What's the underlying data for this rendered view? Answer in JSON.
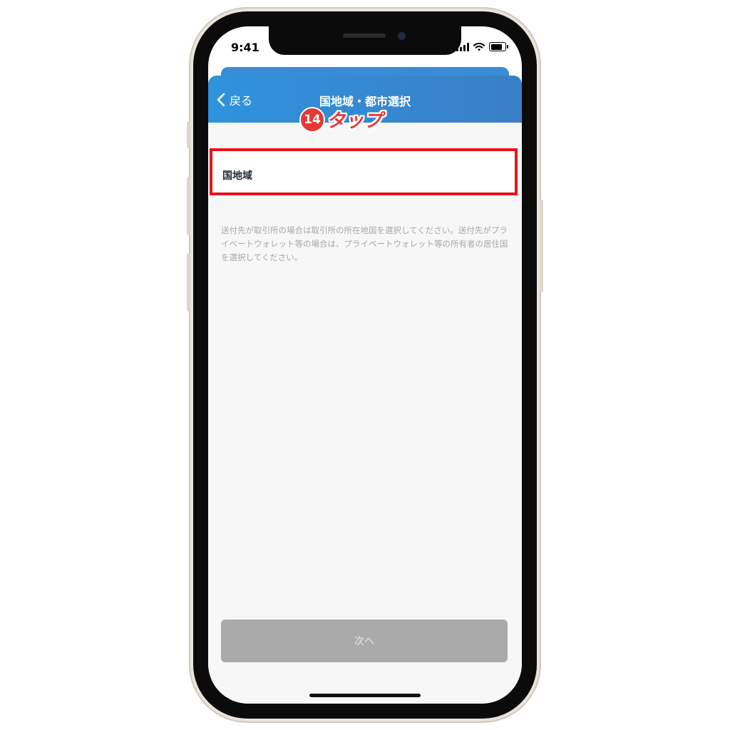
{
  "status_bar": {
    "time": "9:41"
  },
  "nav": {
    "back_label": "戻る",
    "title": "国地域・都市選択"
  },
  "annotation": {
    "step_number": "14",
    "action_text": "タップ"
  },
  "form": {
    "country_region_label": "国地域"
  },
  "help_text": "送付先が取引所の場合は取引所の所在地国を選択してください。送付先がプライベートウォレット等の場合は、プライベートウォレット等の所有者の居住国を選択してください。",
  "footer": {
    "next_button_label": "次へ"
  },
  "colors": {
    "nav_start": "#2f93dd",
    "nav_end": "#3a7fc6",
    "highlight": "#e8141b",
    "disabled_button": "#aaaaaa"
  }
}
